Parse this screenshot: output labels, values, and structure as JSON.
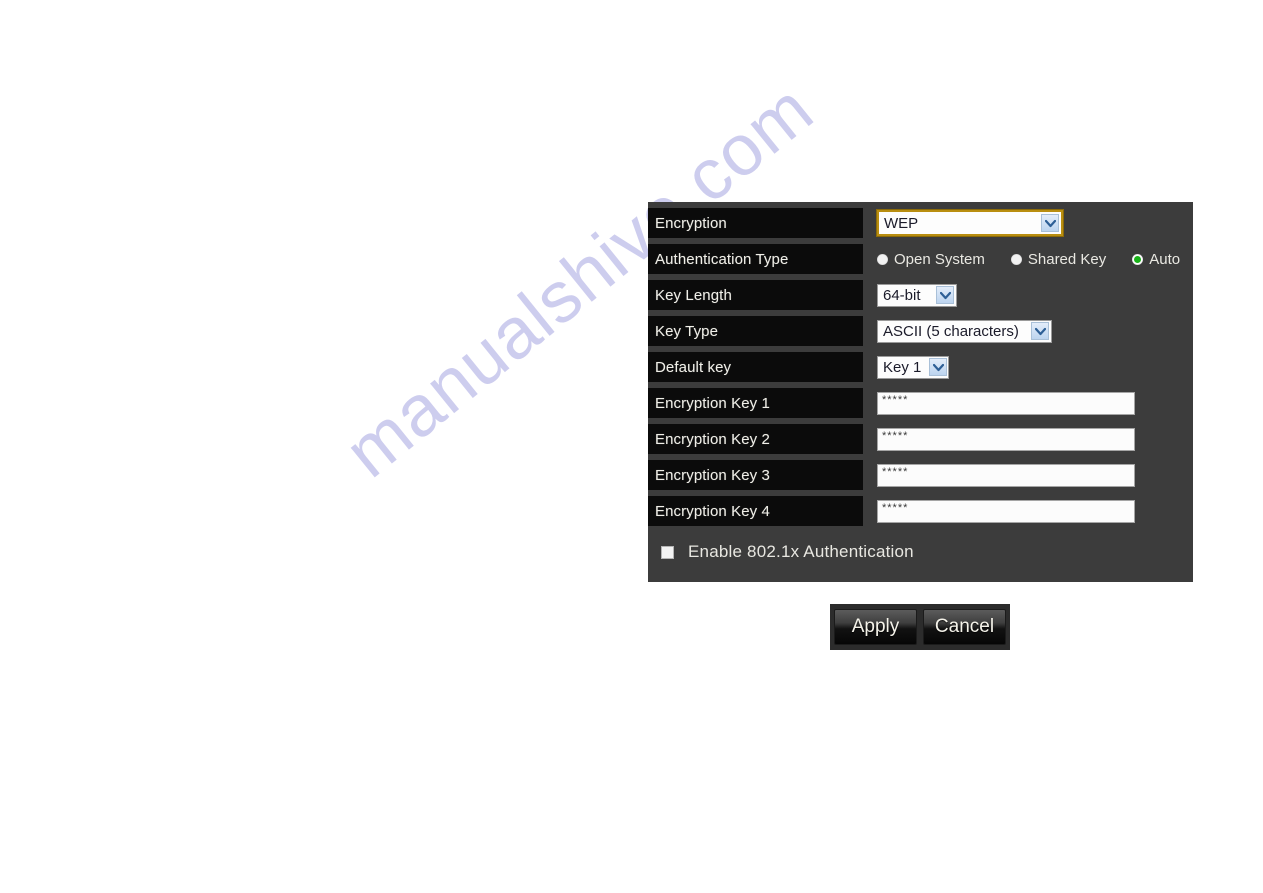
{
  "watermark": {
    "text": "manualshive.com"
  },
  "panel": {
    "rows": [
      {
        "label": "Encryption",
        "control": "select",
        "value": "WEP"
      },
      {
        "label": "Authentication Type",
        "control": "radio",
        "options": [
          "Open System",
          "Shared Key",
          "Auto"
        ],
        "selected": "Auto"
      },
      {
        "label": "Key Length",
        "control": "select",
        "value": "64-bit"
      },
      {
        "label": "Key Type",
        "control": "select",
        "value": "ASCII (5 characters)"
      },
      {
        "label": "Default key",
        "control": "select",
        "value": "Key 1"
      },
      {
        "label": "Encryption Key 1",
        "control": "password",
        "value": "*****"
      },
      {
        "label": "Encryption Key 2",
        "control": "password",
        "value": "*****"
      },
      {
        "label": "Encryption Key 3",
        "control": "password",
        "value": "*****"
      },
      {
        "label": "Encryption Key 4",
        "control": "password",
        "value": "*****"
      }
    ],
    "checkbox": {
      "label": "Enable 802.1x Authentication",
      "checked": false
    }
  },
  "buttons": {
    "apply_label": "Apply",
    "cancel_label": "Cancel"
  },
  "colors": {
    "panel_bg": "#3c3c3c",
    "label_bg": "#0b0b0b",
    "focus_border": "#b98e10",
    "radio_selected": "#19b219",
    "watermark": "#b9b8e8"
  }
}
